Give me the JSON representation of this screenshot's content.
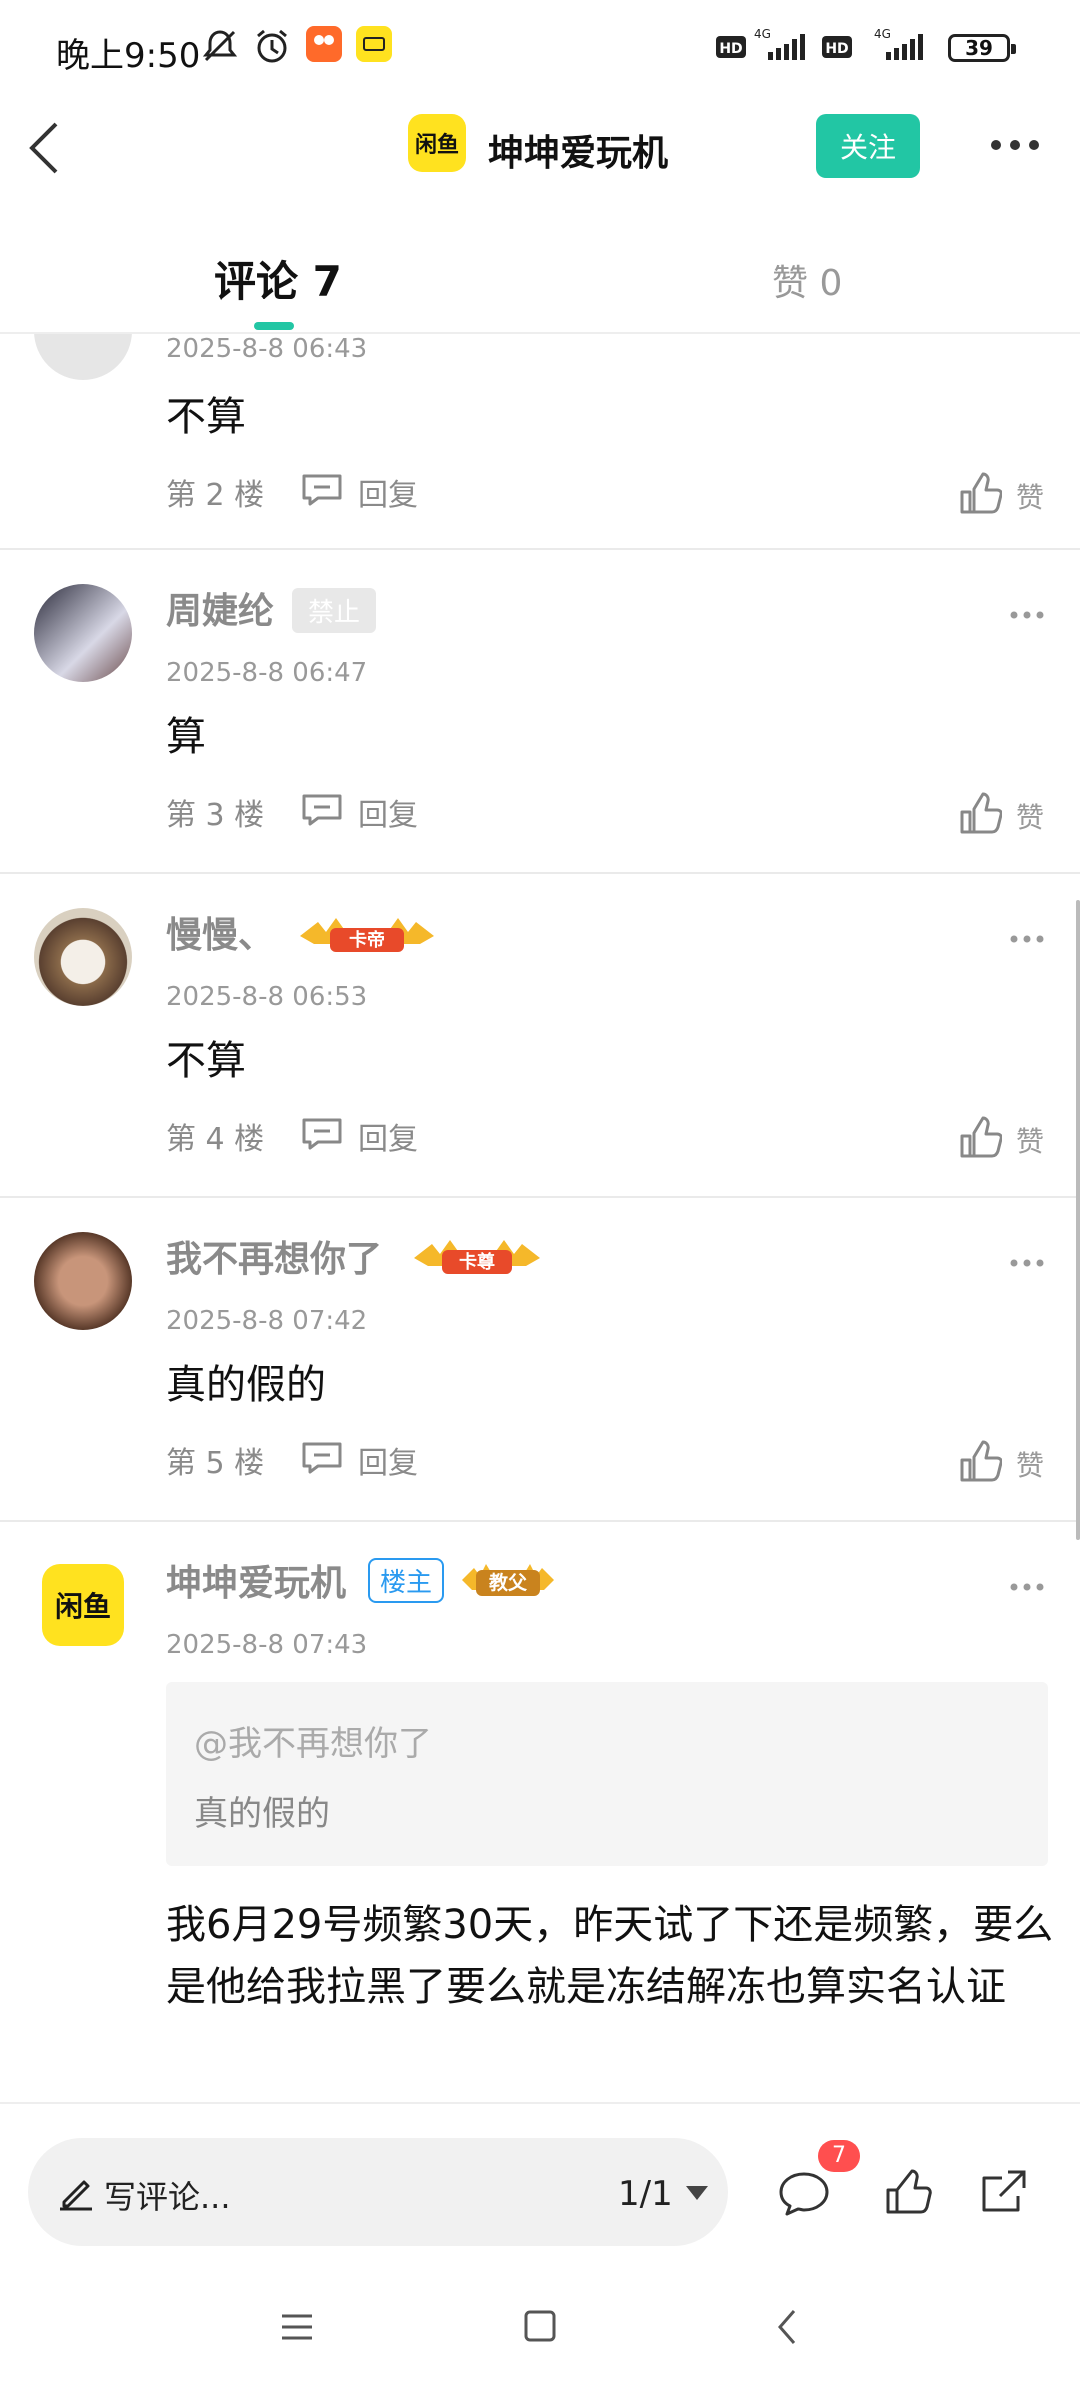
{
  "status_bar": {
    "time": "晚上9:50",
    "battery": "39"
  },
  "header": {
    "logo_text": "闲鱼",
    "title": "坤坤爱玩机",
    "follow_label": "关注"
  },
  "tabs": {
    "comments_label": "评论 7",
    "likes_label": "赞 0"
  },
  "comments": [
    {
      "time": "2025-8-8 06:43",
      "text": "不算",
      "floor": "第 2 楼",
      "reply": "回复",
      "like": "赞"
    },
    {
      "name": "周婕纶",
      "badge": "禁止",
      "time": "2025-8-8 06:47",
      "text": "算",
      "floor": "第 3 楼",
      "reply": "回复",
      "like": "赞"
    },
    {
      "name": "慢慢、",
      "badge": "卡帝",
      "time": "2025-8-8 06:53",
      "text": "不算",
      "floor": "第 4 楼",
      "reply": "回复",
      "like": "赞"
    },
    {
      "name": "我不再想你了",
      "badge": "卡尊",
      "time": "2025-8-8 07:42",
      "text": "真的假的",
      "floor": "第 5 楼",
      "reply": "回复",
      "like": "赞"
    },
    {
      "name": "坤坤爱玩机",
      "owner_badge": "楼主",
      "badge": "教父",
      "avatar_text": "闲鱼",
      "time": "2025-8-8 07:43",
      "quote_name": "@我不再想你了",
      "quote_text": "真的假的",
      "text": "我6月29号频繁30天，昨天试了下还是频繁，要么是他给我拉黑了要么就是冻结解冻也算实名认证"
    }
  ],
  "bottom_bar": {
    "input_placeholder": "写评论...",
    "page": "1/1",
    "comment_count": "7"
  },
  "colors": {
    "accent": "#22c6a4",
    "brand_yellow": "#ffe21f",
    "badge_red": "#ff4f4f",
    "owner_blue": "#2a9af0"
  }
}
